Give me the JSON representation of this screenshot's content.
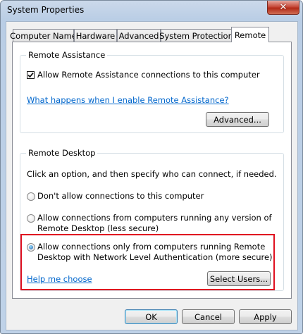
{
  "window": {
    "title": "System Properties",
    "close_glyph": "✕"
  },
  "tabs": [
    {
      "label": "Computer Name"
    },
    {
      "label": "Hardware"
    },
    {
      "label": "Advanced"
    },
    {
      "label": "System Protection"
    },
    {
      "label": "Remote",
      "active": true
    }
  ],
  "remote_assistance": {
    "group_label": "Remote Assistance",
    "allow_checkbox": {
      "label": "Allow Remote Assistance connections to this computer",
      "checked": true
    },
    "help_link": "What happens when I enable Remote Assistance?",
    "advanced_button": "Advanced..."
  },
  "remote_desktop": {
    "group_label": "Remote Desktop",
    "instructions": "Click an option, and then specify who can connect, if needed.",
    "options": [
      {
        "label": "Don't allow connections to this computer",
        "selected": false
      },
      {
        "label_line1": "Allow connections from computers running any version of",
        "label_line2": "Remote Desktop (less secure)",
        "selected": false
      },
      {
        "label_line1": "Allow connections only from computers running Remote",
        "label_line2": "Desktop with Network Level Authentication (more secure)",
        "selected": true
      }
    ],
    "help_link": "Help me choose",
    "select_users_button": "Select Users..."
  },
  "footer": {
    "ok": "OK",
    "cancel": "Cancel",
    "apply": "Apply"
  },
  "colors": {
    "highlight_box": "#e01020",
    "link": "#0066cc"
  }
}
